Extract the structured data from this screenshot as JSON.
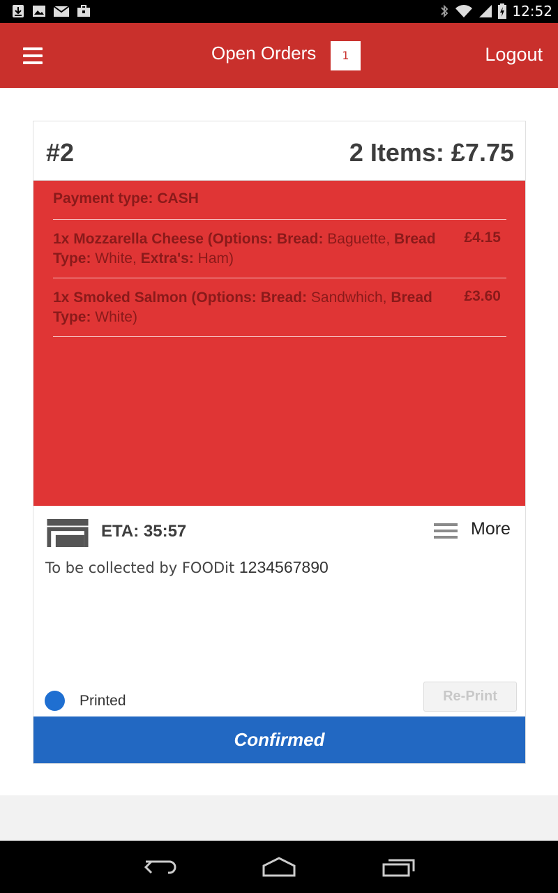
{
  "statusbar": {
    "time": "12:52",
    "icons": [
      "download-icon",
      "image-icon",
      "mail-icon",
      "briefcase-icon",
      "bluetooth-icon",
      "wifi-icon",
      "signal-icon",
      "battery-icon"
    ]
  },
  "appbar": {
    "title": "Open Orders",
    "badge_count": "1",
    "logout_label": "Logout",
    "color": "#c9302c"
  },
  "order": {
    "number": "#2",
    "summary": "2 Items:  £7.75",
    "payment_label": "Payment type: CASH",
    "items": [
      {
        "qty_name": "1x Mozzarella Cheese",
        "opt_prefix": " (Options: ",
        "opt1_key": "Bread:",
        "opt1_val": " Baguette, ",
        "opt2_key": "Bread Type:",
        "opt2_val": " White, ",
        "opt3_key": "Extra's:",
        "opt3_val": " Ham)",
        "price": "£4.15"
      },
      {
        "qty_name": "1x Smoked Salmon",
        "opt_prefix": " (Options: ",
        "opt1_key": "Bread:",
        "opt1_val": " Sandwhich, ",
        "opt2_key": "Bread Type:",
        "opt2_val": " White)",
        "price": "£3.60"
      }
    ],
    "panel_color": "#e03535",
    "eta": "ETA: 35:57",
    "more_label": "More",
    "collect_text": "To be collected by FOODit ",
    "collect_number": "1234567890",
    "printed_label": "Printed",
    "reprint_label": "Re-Print",
    "confirmed_label": "Confirmed",
    "confirmed_color": "#2268c2"
  }
}
